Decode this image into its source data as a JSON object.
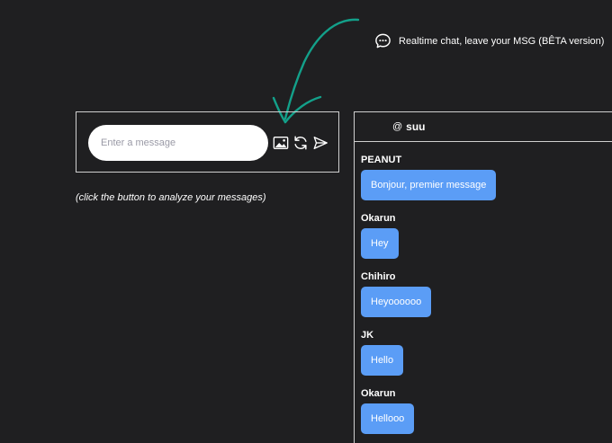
{
  "header": {
    "icon": "chat-bubble-icon",
    "text": "Realtime chat, leave your MSG (BÊTA version)"
  },
  "composer": {
    "placeholder": "Enter a message",
    "value": "",
    "icons": [
      "image-icon",
      "refresh-icon",
      "send-icon"
    ]
  },
  "hint": "(click the button to analyze your messages)",
  "chat": {
    "at": "@",
    "handle": "suu",
    "messages": [
      {
        "author": "PEANUT",
        "text": "Bonjour, premier message"
      },
      {
        "author": "Okarun",
        "text": "Hey"
      },
      {
        "author": "Chihiro",
        "text": "Heyoooooo"
      },
      {
        "author": "JK",
        "text": "Hello"
      },
      {
        "author": "Okarun",
        "text": "Hellooo"
      }
    ]
  },
  "colors": {
    "background": "#1f1f21",
    "bubble": "#5b9df6",
    "annotation_arrow": "#13a08a",
    "border": "#cfcfcf"
  }
}
